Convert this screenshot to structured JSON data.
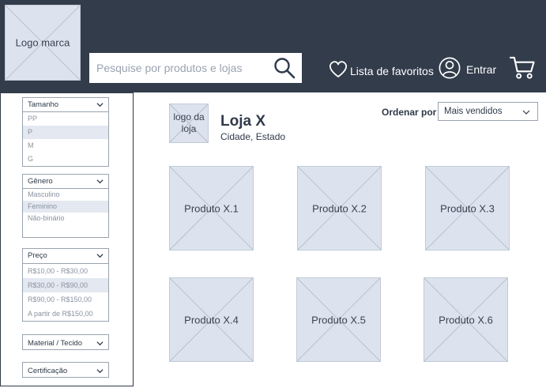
{
  "header": {
    "logo_label": "Logo marca",
    "search_placeholder": "Pesquise por produtos e lojas",
    "favorites_label": "Lista de favoritos",
    "login_label": "Entrar"
  },
  "filters": {
    "tamanho": {
      "label": "Tamanho",
      "options": [
        "PP",
        "P",
        "M",
        "G"
      ],
      "selected": "P"
    },
    "genero": {
      "label": "Gênero",
      "options": [
        "Masculino",
        "Feminino",
        "Não-binário"
      ],
      "selected": "Feminino"
    },
    "preco": {
      "label": "Preço",
      "options": [
        "R$10,00 - R$30,00",
        "R$30,00 - R$90,00",
        "R$90,00 - R$150,00",
        "A partir de R$150,00"
      ],
      "selected": "R$30,00 - R$90,00"
    },
    "material": {
      "label": "Material / Tecido"
    },
    "certificacao": {
      "label": "Certificação"
    }
  },
  "store": {
    "logo_line1": "logo da",
    "logo_line2": "loja",
    "name": "Loja X",
    "location": "Cidade, Estado"
  },
  "sort": {
    "label": "Ordenar por",
    "value": "Mais vendidos"
  },
  "products": [
    "Produto X.1",
    "Produto X.2",
    "Produto X.3",
    "Produto X.4",
    "Produto X.5",
    "Produto X.6"
  ],
  "colors": {
    "header_bg": "#323c4b",
    "placeholder_bg": "#dde3ee"
  }
}
